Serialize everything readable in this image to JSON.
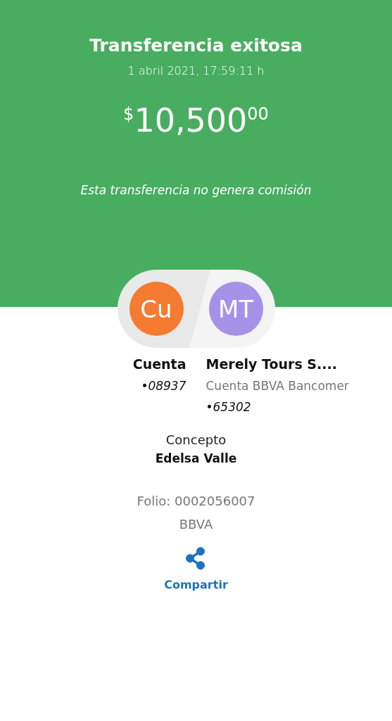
{
  "header": {
    "title": "Transferencia exitosa",
    "datetime": "1 abril 2021, 17:59:11 h",
    "amount": {
      "currency": "$",
      "integer": "10,500",
      "cents": "00"
    },
    "note": "Esta transferencia no genera comisión"
  },
  "parties": [
    {
      "initials": "Cu",
      "color": "#f47b30",
      "name": "Cuenta",
      "account": "•08937"
    },
    {
      "initials": "MT",
      "color": "#a592e8",
      "name": "Merely Tours S....",
      "bank": "Cuenta BBVA Bancomer",
      "account": "•65302"
    }
  ],
  "concept": {
    "label": "Concepto",
    "value": "Edelsa Valle"
  },
  "folio": "Folio: 0002056007",
  "issuer": "BBVA",
  "share": {
    "label": "Compartir"
  }
}
